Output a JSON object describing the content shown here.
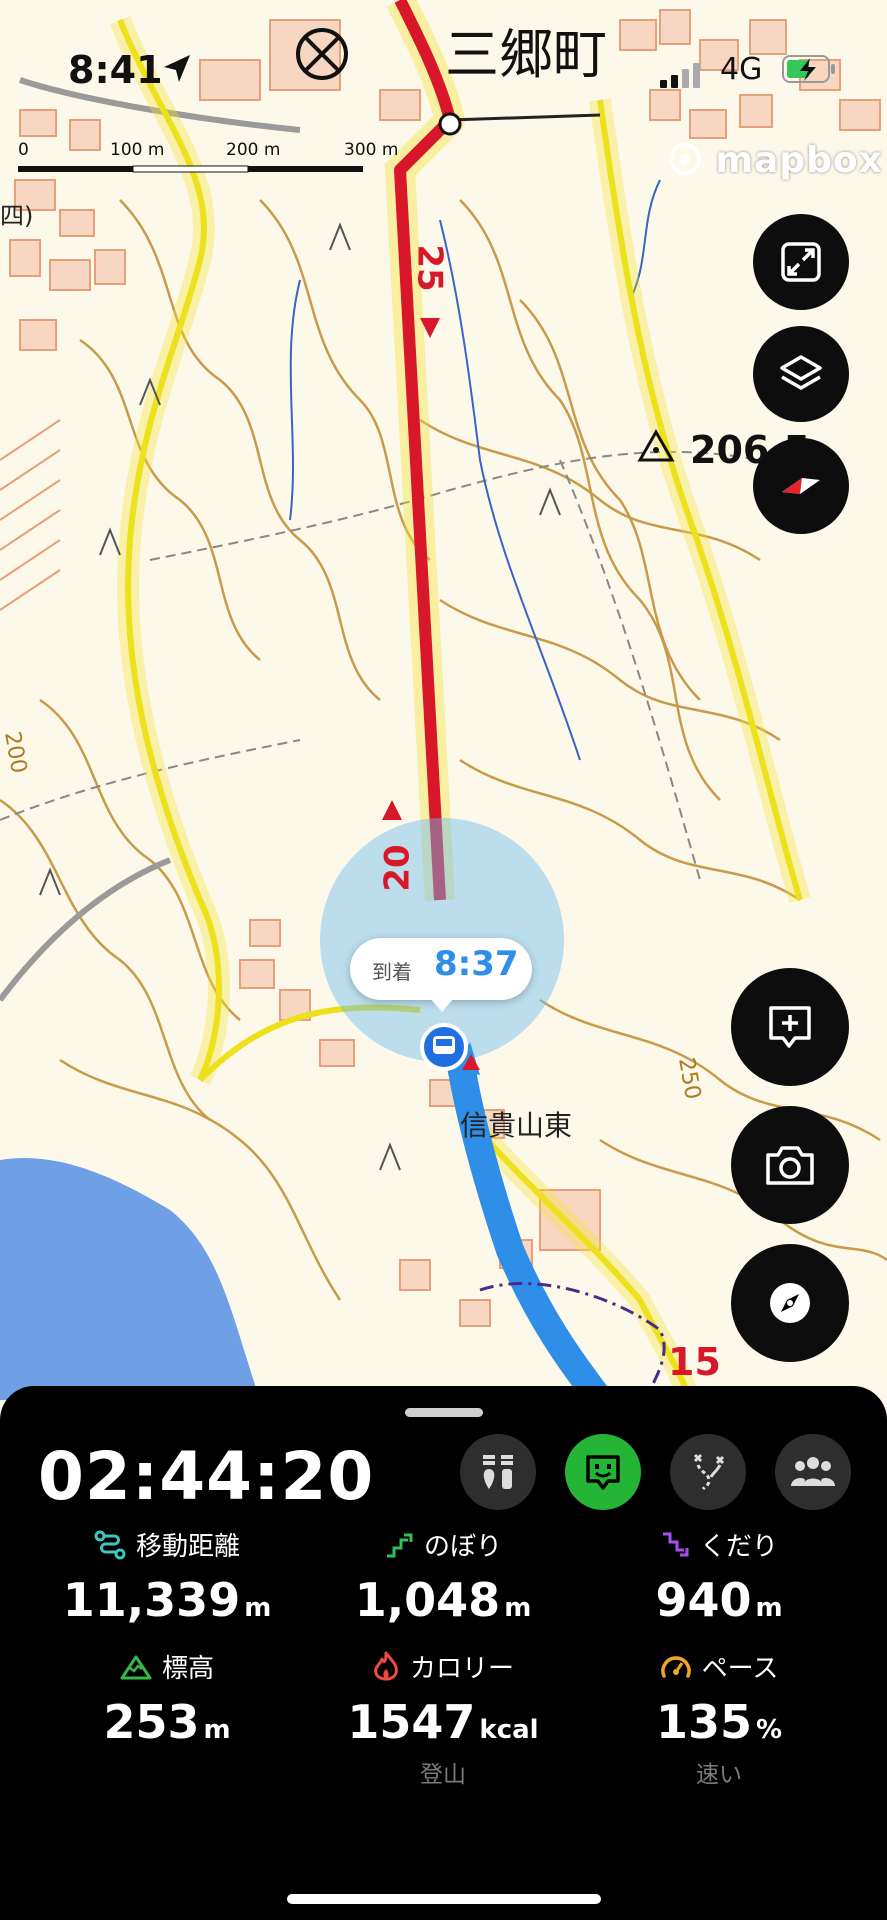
{
  "status_bar": {
    "time": "8:41",
    "network": "4G"
  },
  "map": {
    "place_name": "三郷町",
    "scale": {
      "labels": [
        "0",
        "100 m",
        "200 m",
        "300 m"
      ]
    },
    "attribution": "mapbox",
    "summit_label": "206.5",
    "stop_label": "信貴山東",
    "route_markers": [
      "25",
      "20",
      "15"
    ],
    "contour_labels": [
      "200",
      "250"
    ],
    "edge_label": "四)",
    "arrival_callout": {
      "label": "到着",
      "time": "8:37"
    }
  },
  "map_controls": [
    {
      "name": "expand-icon"
    },
    {
      "name": "layers-icon"
    },
    {
      "name": "route-direction-icon"
    },
    {
      "name": "add-note-icon"
    },
    {
      "name": "camera-icon"
    },
    {
      "name": "compass-icon"
    }
  ],
  "panel": {
    "elapsed_time": "02:44:20",
    "tabs": [
      {
        "name": "gear-tab-icon",
        "active": false
      },
      {
        "name": "face-tab-icon",
        "active": true
      },
      {
        "name": "route-tab-icon",
        "active": false
      },
      {
        "name": "group-tab-icon",
        "active": false
      }
    ],
    "stats": [
      {
        "label": "移動距離",
        "value": "11,339",
        "unit": "m",
        "icon": "distance-icon",
        "color": "#3fc6c0"
      },
      {
        "label": "のぼり",
        "value": "1,048",
        "unit": "m",
        "icon": "ascent-icon",
        "color": "#2fc152"
      },
      {
        "label": "くだり",
        "value": "940",
        "unit": "m",
        "icon": "descent-icon",
        "color": "#a64ff0"
      },
      {
        "label": "標高",
        "value": "253",
        "unit": "m",
        "icon": "mountain-icon",
        "color": "#3ab54a"
      },
      {
        "label": "カロリー",
        "value": "1547",
        "unit": "kcal",
        "icon": "flame-icon",
        "color": "#ef4b3f",
        "sub": "登山"
      },
      {
        "label": "ペース",
        "value": "135",
        "unit": "%",
        "icon": "speedometer-icon",
        "color": "#f3a526",
        "sub": "速い"
      }
    ]
  },
  "colors": {
    "route_red": "#d8182a",
    "track_blue": "#2f8fe8",
    "trail_yellow": "#f2e233",
    "contour": "#c08a2e",
    "accent_green": "#24b536"
  }
}
